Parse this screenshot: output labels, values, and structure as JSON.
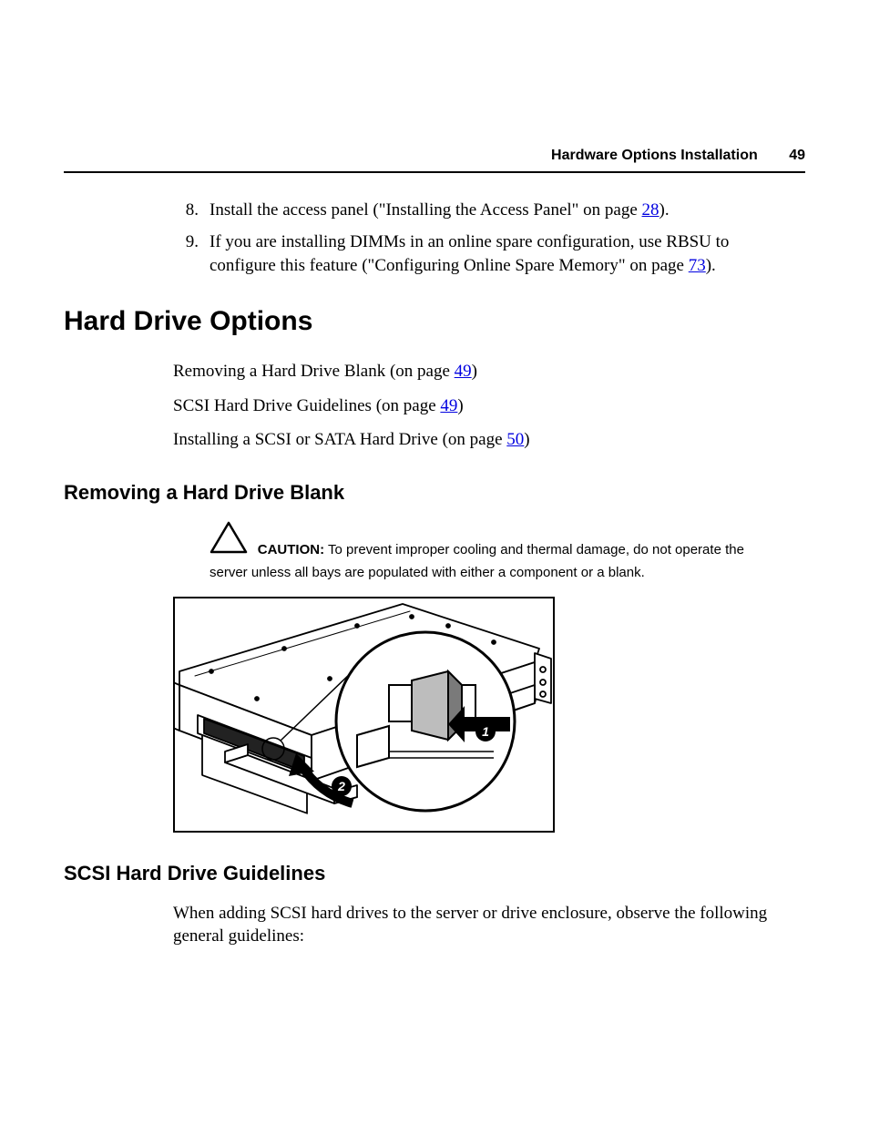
{
  "header": {
    "title": "Hardware Options Installation",
    "page": "49"
  },
  "steps": [
    {
      "num": "8.",
      "pre": "Install the access panel (\"Installing the Access Panel\" on page ",
      "link": "28",
      "post": ")."
    },
    {
      "num": "9.",
      "pre": "If you are installing DIMMs in an online spare configuration, use RBSU to configure this feature (\"Configuring Online Spare Memory\" on page ",
      "link": "73",
      "post": ")."
    }
  ],
  "h1": "Hard Drive Options",
  "toc": [
    {
      "pre": "Removing a Hard Drive Blank (on page ",
      "link": "49",
      "post": ")"
    },
    {
      "pre": "SCSI Hard Drive Guidelines (on page ",
      "link": "49",
      "post": ")"
    },
    {
      "pre": "Installing a SCSI or SATA Hard Drive (on page ",
      "link": "50",
      "post": ")"
    }
  ],
  "sub1": "Removing a Hard Drive Blank",
  "caution": {
    "label": "CAUTION:",
    "text": "  To prevent improper cooling and thermal damage, do not operate the server unless all bays are populated with either a component or a blank."
  },
  "figure": {
    "callouts": [
      "1",
      "2"
    ]
  },
  "sub2": "SCSI Hard Drive Guidelines",
  "body2": "When adding SCSI hard drives to the server or drive enclosure, observe the following general guidelines:"
}
